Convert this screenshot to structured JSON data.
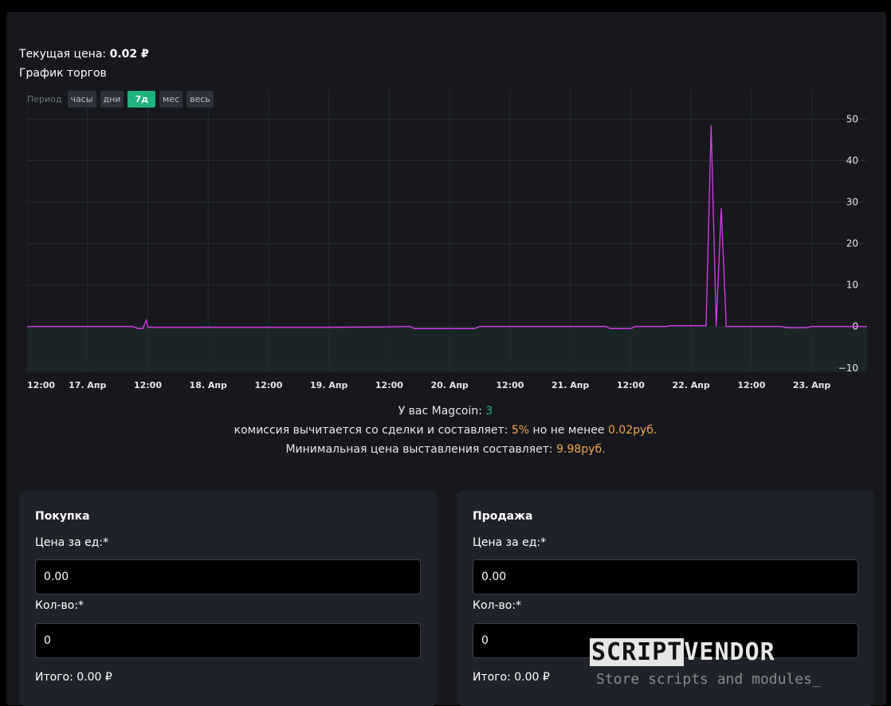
{
  "header": {
    "current_price_label": "Текущая цена:",
    "current_price_value": "0.02 ₽",
    "graph_title": "График торгов"
  },
  "period": {
    "label": "Период",
    "buttons": [
      "часы",
      "дни",
      "7д",
      "мес",
      "весь"
    ],
    "active": "7д"
  },
  "chart_data": {
    "type": "line",
    "y_ticks": [
      "50",
      "40",
      "30",
      "20",
      "10",
      "0",
      "−10"
    ],
    "x_tick_labels": [
      "12:00",
      "17. Апр",
      "12:00",
      "18. Апр",
      "12:00",
      "19. Апр",
      "12:00",
      "20. Апр",
      "12:00",
      "21. Апр",
      "12:00",
      "22. Апр",
      "12:00",
      "23. Апр"
    ],
    "ylim": [
      -11,
      57
    ],
    "x_unit": "hours",
    "xlim": [
      0,
      167
    ],
    "x_ticks": [
      0,
      12,
      24,
      36,
      48,
      60,
      72,
      84,
      96,
      108,
      120,
      132,
      144,
      156
    ],
    "series": [
      {
        "color": "#d93cf0",
        "points": [
          [
            0,
            0
          ],
          [
            21,
            0
          ],
          [
            22,
            -0.5
          ],
          [
            23,
            -0.5
          ],
          [
            23.7,
            1.5
          ],
          [
            24,
            -0.2
          ],
          [
            35,
            -0.2
          ],
          [
            47,
            -0.2
          ],
          [
            59,
            -0.2
          ],
          [
            71,
            -0.1
          ],
          [
            76,
            0
          ],
          [
            77,
            -0.5
          ],
          [
            89,
            -0.5
          ],
          [
            90,
            0
          ],
          [
            95,
            0
          ],
          [
            107,
            0
          ],
          [
            115,
            0
          ],
          [
            116,
            -0.5
          ],
          [
            120,
            -0.5
          ],
          [
            121,
            0
          ],
          [
            127,
            0
          ],
          [
            128,
            0.2
          ],
          [
            135,
            0.2
          ],
          [
            136,
            48.5
          ],
          [
            137,
            0
          ],
          [
            138,
            28.5
          ],
          [
            139,
            0
          ],
          [
            142,
            0
          ],
          [
            150,
            0
          ],
          [
            151,
            -0.3
          ],
          [
            155,
            -0.3
          ],
          [
            156,
            0
          ],
          [
            167,
            0
          ]
        ]
      }
    ]
  },
  "balance": {
    "label": "У вас Magcoin:",
    "value": "3"
  },
  "commission": {
    "text1": "комиссия вычитается со сделки и составляет:",
    "percent": "5%",
    "text2": "но не менее",
    "min": "0.02руб."
  },
  "min_price": {
    "text": "Минимальная цена выставления составляет:",
    "value": "9.98руб."
  },
  "buy": {
    "title": "Покупка",
    "price_label": "Цена за ед:*",
    "price_value": "0.00",
    "qty_label": "Кол-во:*",
    "qty_value": "0",
    "total_label": "Итого: 0.00 ₽"
  },
  "sell": {
    "title": "Продажа",
    "price_label": "Цена за ед:*",
    "price_value": "0.00",
    "qty_label": "Кол-во:*",
    "qty_value": "0",
    "total_label": "Итого: 0.00 ₽"
  },
  "watermark": {
    "brand_part1": "SCRIPT",
    "brand_part2": "VENDOR",
    "tagline": "Store scripts and modules_"
  }
}
